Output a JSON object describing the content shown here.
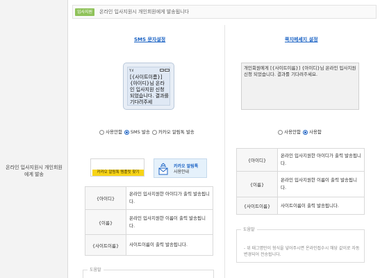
{
  "left": {
    "label_line1": "온라인 입사지원시 개인회원",
    "label_line2": "에게 발송"
  },
  "topbar": {
    "badge": "입사지원",
    "text": "온라인 입사지원시 개인회원에게 발송됩니다"
  },
  "sms": {
    "title": "SMS 문자설정",
    "signal": "Y.ıl",
    "message": "[{사이트이름}] {아이디}님 온라인 입사지원 신청 되었습니다. 결과를 기다려주세",
    "radio": [
      {
        "label": "사용안함",
        "checked": false
      },
      {
        "label": "SMS 발송",
        "checked": true
      },
      {
        "label": "카카오 알림톡 발송",
        "checked": false
      }
    ],
    "template_button": "카카오 알림톡 템플릿 찾기",
    "guide_line1": "카카오 알림톡",
    "guide_line2": "사용안내",
    "rows": [
      {
        "key": "{아이디}",
        "desc": "온라인 입사지원한 아이디가 출력 발송됩니다."
      },
      {
        "key": "{이름}",
        "desc": "온라인 입사지원한 이름이 출력 발송됩니다."
      },
      {
        "key": "{사이트이름}",
        "desc": "사이트이름이 출력 발송됩니다."
      }
    ],
    "help_legend": "도움말"
  },
  "kakao": {
    "title": "쪽지메세지 설정",
    "message": "개인회원에게 [{사이트이름}] {아이디}님 온라인 입사지원 신청 되었습니다. 결과를 기다려주세요.",
    "radio": [
      {
        "label": "사용안함",
        "checked": false
      },
      {
        "label": "사용함",
        "checked": true
      }
    ],
    "rows": [
      {
        "key": "{아이디}",
        "desc": "온라인 입사지원한 아이디가 출력 발송됩니다."
      },
      {
        "key": "{이름}",
        "desc": "온라인 입사지원한 이름이 출력 발송됩니다."
      },
      {
        "key": "{사이트이름}",
        "desc": "사이트이름이 출력 발송됩니다."
      }
    ],
    "help_legend": "도움말",
    "help_text": "- 위 태그명만이 형식을 넣어주시면 온라인접수시 해당 값이로 자동변경되어 전송됩니다."
  },
  "colors": {
    "badge": "#8fc25a",
    "link": "#1a62c4",
    "kakao_yellow": "#f7d417"
  }
}
